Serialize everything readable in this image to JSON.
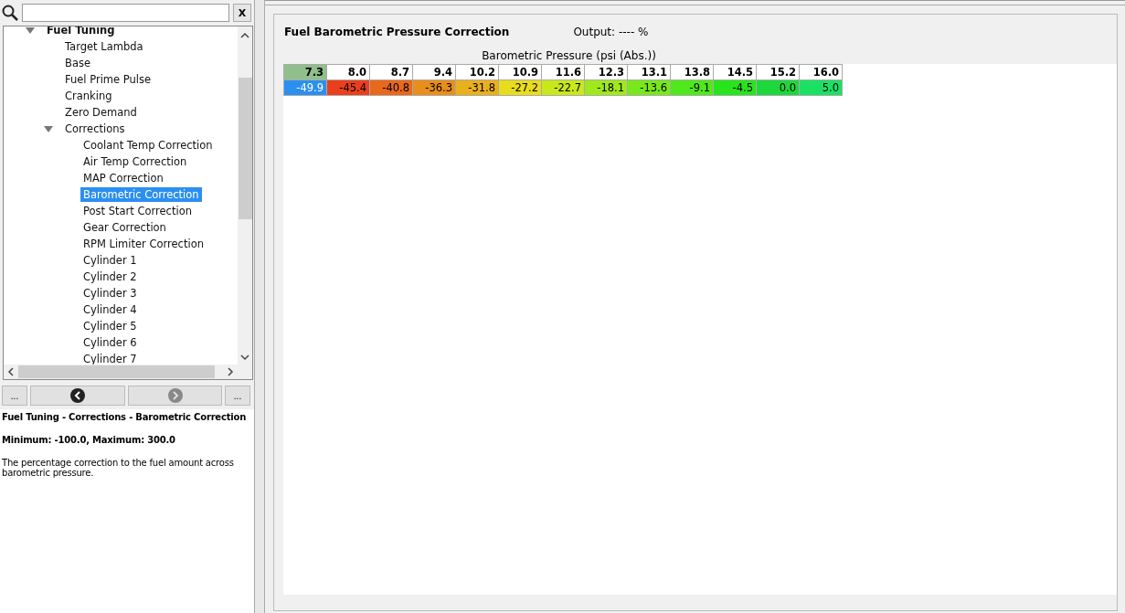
{
  "search": {
    "clear_label": "X"
  },
  "tree": [
    {
      "label": "Fuel Tuning",
      "expanded": true,
      "selected": false,
      "children": [
        {
          "label": "Target Lambda",
          "selected": false
        },
        {
          "label": "Base",
          "selected": false
        },
        {
          "label": "Fuel Prime Pulse",
          "selected": false
        },
        {
          "label": "Cranking",
          "selected": false
        },
        {
          "label": "Zero Demand",
          "selected": false
        },
        {
          "label": "Corrections",
          "expanded": true,
          "selected": false,
          "children": [
            {
              "label": "Coolant Temp Correction",
              "selected": false
            },
            {
              "label": "Air Temp Correction",
              "selected": false
            },
            {
              "label": "MAP Correction",
              "selected": false
            },
            {
              "label": "Barometric Correction",
              "selected": true
            },
            {
              "label": "Post Start Correction",
              "selected": false
            },
            {
              "label": "Gear Correction",
              "selected": false
            },
            {
              "label": "RPM Limiter Correction",
              "selected": false
            },
            {
              "label": "Cylinder 1",
              "selected": false
            },
            {
              "label": "Cylinder 2",
              "selected": false
            },
            {
              "label": "Cylinder 3",
              "selected": false
            },
            {
              "label": "Cylinder 4",
              "selected": false
            },
            {
              "label": "Cylinder 5",
              "selected": false
            },
            {
              "label": "Cylinder 6",
              "selected": false
            },
            {
              "label": "Cylinder 7",
              "selected": false
            }
          ]
        }
      ]
    }
  ],
  "nav": {
    "left_more": "...",
    "right_more": "...",
    "back_disabled": false,
    "forward_disabled": true
  },
  "info": {
    "path": "Fuel Tuning - Corrections - Barometric Correction",
    "limits": "Minimum: -100.0, Maximum: 300.0",
    "description": "The percentage correction to the fuel amount across barometric pressure."
  },
  "table": {
    "title": "Fuel Barometric Pressure Correction",
    "output": "Output: ---- %",
    "axis_label": "Barometric Pressure (psi (Abs.))",
    "columns": [
      {
        "label": "7.3",
        "selected": true
      },
      {
        "label": "8.0",
        "selected": false
      },
      {
        "label": "8.7",
        "selected": false
      },
      {
        "label": "9.4",
        "selected": false
      },
      {
        "label": "10.2",
        "selected": false
      },
      {
        "label": "10.9",
        "selected": false
      },
      {
        "label": "11.6",
        "selected": false
      },
      {
        "label": "12.3",
        "selected": false
      },
      {
        "label": "13.1",
        "selected": false
      },
      {
        "label": "13.8",
        "selected": false
      },
      {
        "label": "14.5",
        "selected": false
      },
      {
        "label": "15.2",
        "selected": false
      },
      {
        "label": "16.0",
        "selected": false
      }
    ],
    "values": [
      {
        "text": "-49.9",
        "selected": true
      },
      {
        "text": "-45.4",
        "selected": false,
        "color": "#e8401c"
      },
      {
        "text": "-40.8",
        "selected": false,
        "color": "#e8681c"
      },
      {
        "text": "-36.3",
        "selected": false,
        "color": "#e88e1c"
      },
      {
        "text": "-31.8",
        "selected": false,
        "color": "#e8b01c"
      },
      {
        "text": "-27.2",
        "selected": false,
        "color": "#e8dc1c"
      },
      {
        "text": "-22.7",
        "selected": false,
        "color": "#c8e81c"
      },
      {
        "text": "-18.1",
        "selected": false,
        "color": "#a0e81c"
      },
      {
        "text": "-13.6",
        "selected": false,
        "color": "#78e81c"
      },
      {
        "text": "-9.1",
        "selected": false,
        "color": "#50e81c"
      },
      {
        "text": "-4.5",
        "selected": false,
        "color": "#28e41c"
      },
      {
        "text": "0.0",
        "selected": false,
        "color": "#1cd83c"
      },
      {
        "text": "5.0",
        "selected": false,
        "color": "#1ce064"
      }
    ]
  }
}
